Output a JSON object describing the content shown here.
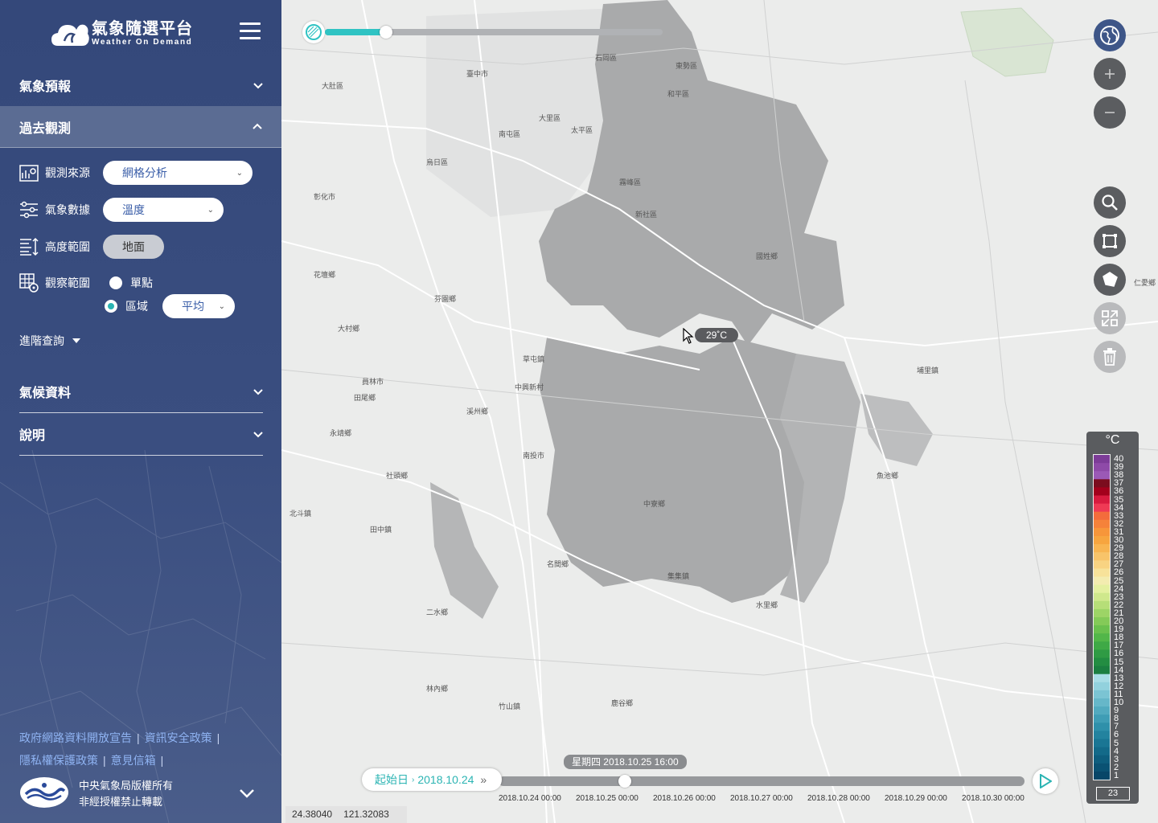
{
  "brand": {
    "title": "氣象隨選平台",
    "subtitle": "Weather On Demand"
  },
  "sidebar": {
    "sections": {
      "forecast": "氣象預報",
      "past_obs": "過去觀測",
      "climate": "氣候資料",
      "help": "說明"
    },
    "form": {
      "source_label": "觀測來源",
      "source_value": "網格分析",
      "data_label": "氣象數據",
      "data_value": "溫度",
      "height_label": "高度範圍",
      "height_value": "地面",
      "scope_label": "觀察範圍",
      "point_label": "單點",
      "area_label": "區域",
      "area_stat": "平均"
    },
    "advanced": "進階查詢",
    "links": [
      "政府網路資料開放宣告",
      "資訊安全政策",
      "隱私權保護政策",
      "意見信箱"
    ],
    "footer": {
      "line1": "中央氣象局版權所有",
      "line2": "非經授權禁止轉載"
    }
  },
  "map": {
    "tooltip": "29˚C",
    "opacity_slider": 0.18,
    "controls": [
      "globe-icon",
      "zoom-in-icon",
      "zoom-out-icon",
      "search-icon",
      "rectangle-select-icon",
      "polygon-select-icon",
      "fit-extent-icon",
      "trash-icon"
    ],
    "labels": [
      "臺中市",
      "南屯區",
      "大里區",
      "太平區",
      "霧峰區",
      "草屯鎮",
      "南投市",
      "名間鄉",
      "集集鎮",
      "中寮鄉",
      "國姓鄉",
      "埔里鎮",
      "魚池鄉",
      "水里鄉",
      "竹山鎮",
      "鹿谷鄉",
      "田中鎮",
      "二水鄉",
      "社頭鄉",
      "員林市",
      "大村鄉",
      "花壇鄉",
      "芬園鄉",
      "北斗鎮",
      "田尾鄉",
      "永靖鄉",
      "溪州鄉",
      "林內鄉",
      "烏日區",
      "大肚區",
      "彰化市",
      "和平區",
      "新社區",
      "東勢區",
      "石岡區",
      "中興新村",
      "仁愛鄉"
    ]
  },
  "legend": {
    "unit": "°C",
    "values": [
      40,
      39,
      38,
      37,
      36,
      35,
      34,
      33,
      32,
      31,
      30,
      29,
      28,
      27,
      26,
      25,
      24,
      23,
      22,
      21,
      20,
      19,
      18,
      17,
      16,
      15,
      14,
      13,
      12,
      11,
      10,
      9,
      8,
      7,
      6,
      5,
      4,
      3,
      2,
      1
    ],
    "current": "23",
    "colors": [
      "#7d3c98",
      "#8e4aa8",
      "#9b59b6",
      "#7b0d1e",
      "#a3001c",
      "#d81b3f",
      "#ef3a55",
      "#f36c3c",
      "#f5823a",
      "#f7963a",
      "#f7a53f",
      "#f8b552",
      "#f8c46a",
      "#f8d382",
      "#f7e29a",
      "#f3ecb0",
      "#e4f0a0",
      "#cfe88c",
      "#b6de78",
      "#9dd466",
      "#84ca58",
      "#6ac04e",
      "#52b649",
      "#3fa946",
      "#2f9b44",
      "#238d42",
      "#1b7f41",
      "#a8dde6",
      "#92d1dd",
      "#7bc4d3",
      "#66b7c9",
      "#52aabf",
      "#3f9db5",
      "#2f90aa",
      "#23839f",
      "#1a7694",
      "#136a89",
      "#0e5e7e",
      "#0a5273",
      "#074668"
    ]
  },
  "timeline": {
    "start_label": "起始日",
    "start_date": "2018.10.24",
    "current": "星期四 2018.10.25 16:00",
    "progress": 0.24,
    "ticks": [
      "2018.10.24 00:00",
      "2018.10.25 00:00",
      "2018.10.26 00:00",
      "2018.10.27 00:00",
      "2018.10.28 00:00",
      "2018.10.29 00:00",
      "2018.10.30 00:00"
    ]
  },
  "coords": {
    "lat": "24.38040",
    "lon": "121.32083"
  }
}
